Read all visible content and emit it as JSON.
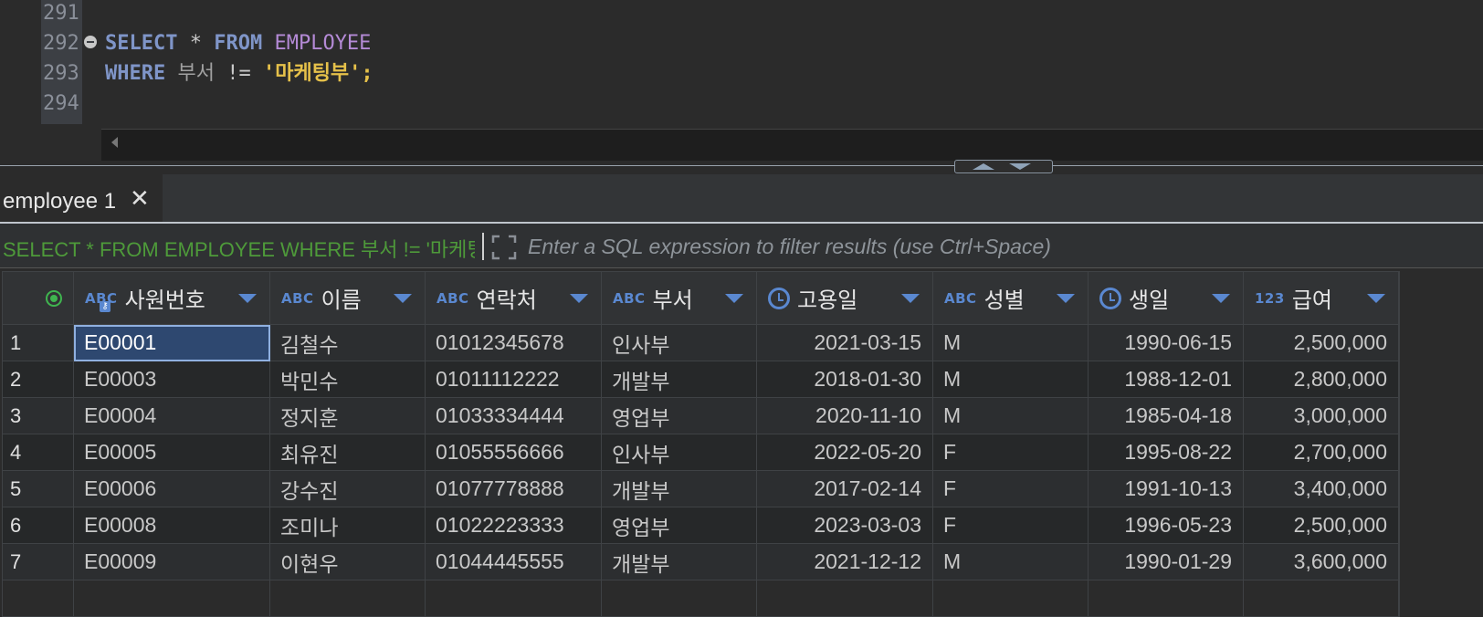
{
  "editor": {
    "line_numbers": [
      "291",
      "292",
      "293",
      "294"
    ],
    "line292": {
      "kw1": "SELECT",
      "star": " * ",
      "kw2": "FROM",
      "table": " EMPLOYEE"
    },
    "line293": {
      "kw": "WHERE",
      "col": " 부서 ",
      "op": "!=",
      "str": " '마케팅부'",
      "semi": ";"
    }
  },
  "result_tab": {
    "label": "employee 1",
    "close_icon": "close-icon"
  },
  "filter": {
    "query": "SELECT * FROM EMPLOYEE WHERE 부서 != '마케팅부'",
    "placeholder": "Enter a SQL expression to filter results (use Ctrl+Space)",
    "expand_icon": "expand-icon"
  },
  "grid": {
    "columns": [
      {
        "type": "ABC",
        "name": "사원번호",
        "icon": "text-type-icon"
      },
      {
        "type": "ABC",
        "name": "이름",
        "icon": "text-type-icon"
      },
      {
        "type": "ABC",
        "name": "연락처",
        "icon": "text-type-icon"
      },
      {
        "type": "ABC",
        "name": "부서",
        "icon": "text-type-icon"
      },
      {
        "type": "",
        "name": "고용일",
        "icon": "clock-icon"
      },
      {
        "type": "ABC",
        "name": "성별",
        "icon": "text-type-icon"
      },
      {
        "type": "",
        "name": "생일",
        "icon": "clock-icon"
      },
      {
        "type": "123",
        "name": "급여",
        "icon": "number-type-icon"
      }
    ],
    "rows": [
      {
        "n": "1",
        "c": [
          "E00001",
          "김철수",
          "01012345678",
          "인사부",
          "2021-03-15",
          "M",
          "1990-06-15",
          "2,500,000"
        ]
      },
      {
        "n": "2",
        "c": [
          "E00003",
          "박민수",
          "01011112222",
          "개발부",
          "2018-01-30",
          "M",
          "1988-12-01",
          "2,800,000"
        ]
      },
      {
        "n": "3",
        "c": [
          "E00004",
          "정지훈",
          "01033334444",
          "영업부",
          "2020-11-10",
          "M",
          "1985-04-18",
          "3,000,000"
        ]
      },
      {
        "n": "4",
        "c": [
          "E00005",
          "최유진",
          "01055556666",
          "인사부",
          "2022-05-20",
          "F",
          "1995-08-22",
          "2,700,000"
        ]
      },
      {
        "n": "5",
        "c": [
          "E00006",
          "강수진",
          "01077778888",
          "개발부",
          "2017-02-14",
          "F",
          "1991-10-13",
          "3,400,000"
        ]
      },
      {
        "n": "6",
        "c": [
          "E00008",
          "조미나",
          "01022223333",
          "영업부",
          "2023-03-03",
          "F",
          "1996-05-23",
          "2,500,000"
        ]
      },
      {
        "n": "7",
        "c": [
          "E00009",
          "이현우",
          "01044445555",
          "개발부",
          "2021-12-12",
          "M",
          "1990-01-29",
          "3,600,000"
        ]
      }
    ]
  }
}
